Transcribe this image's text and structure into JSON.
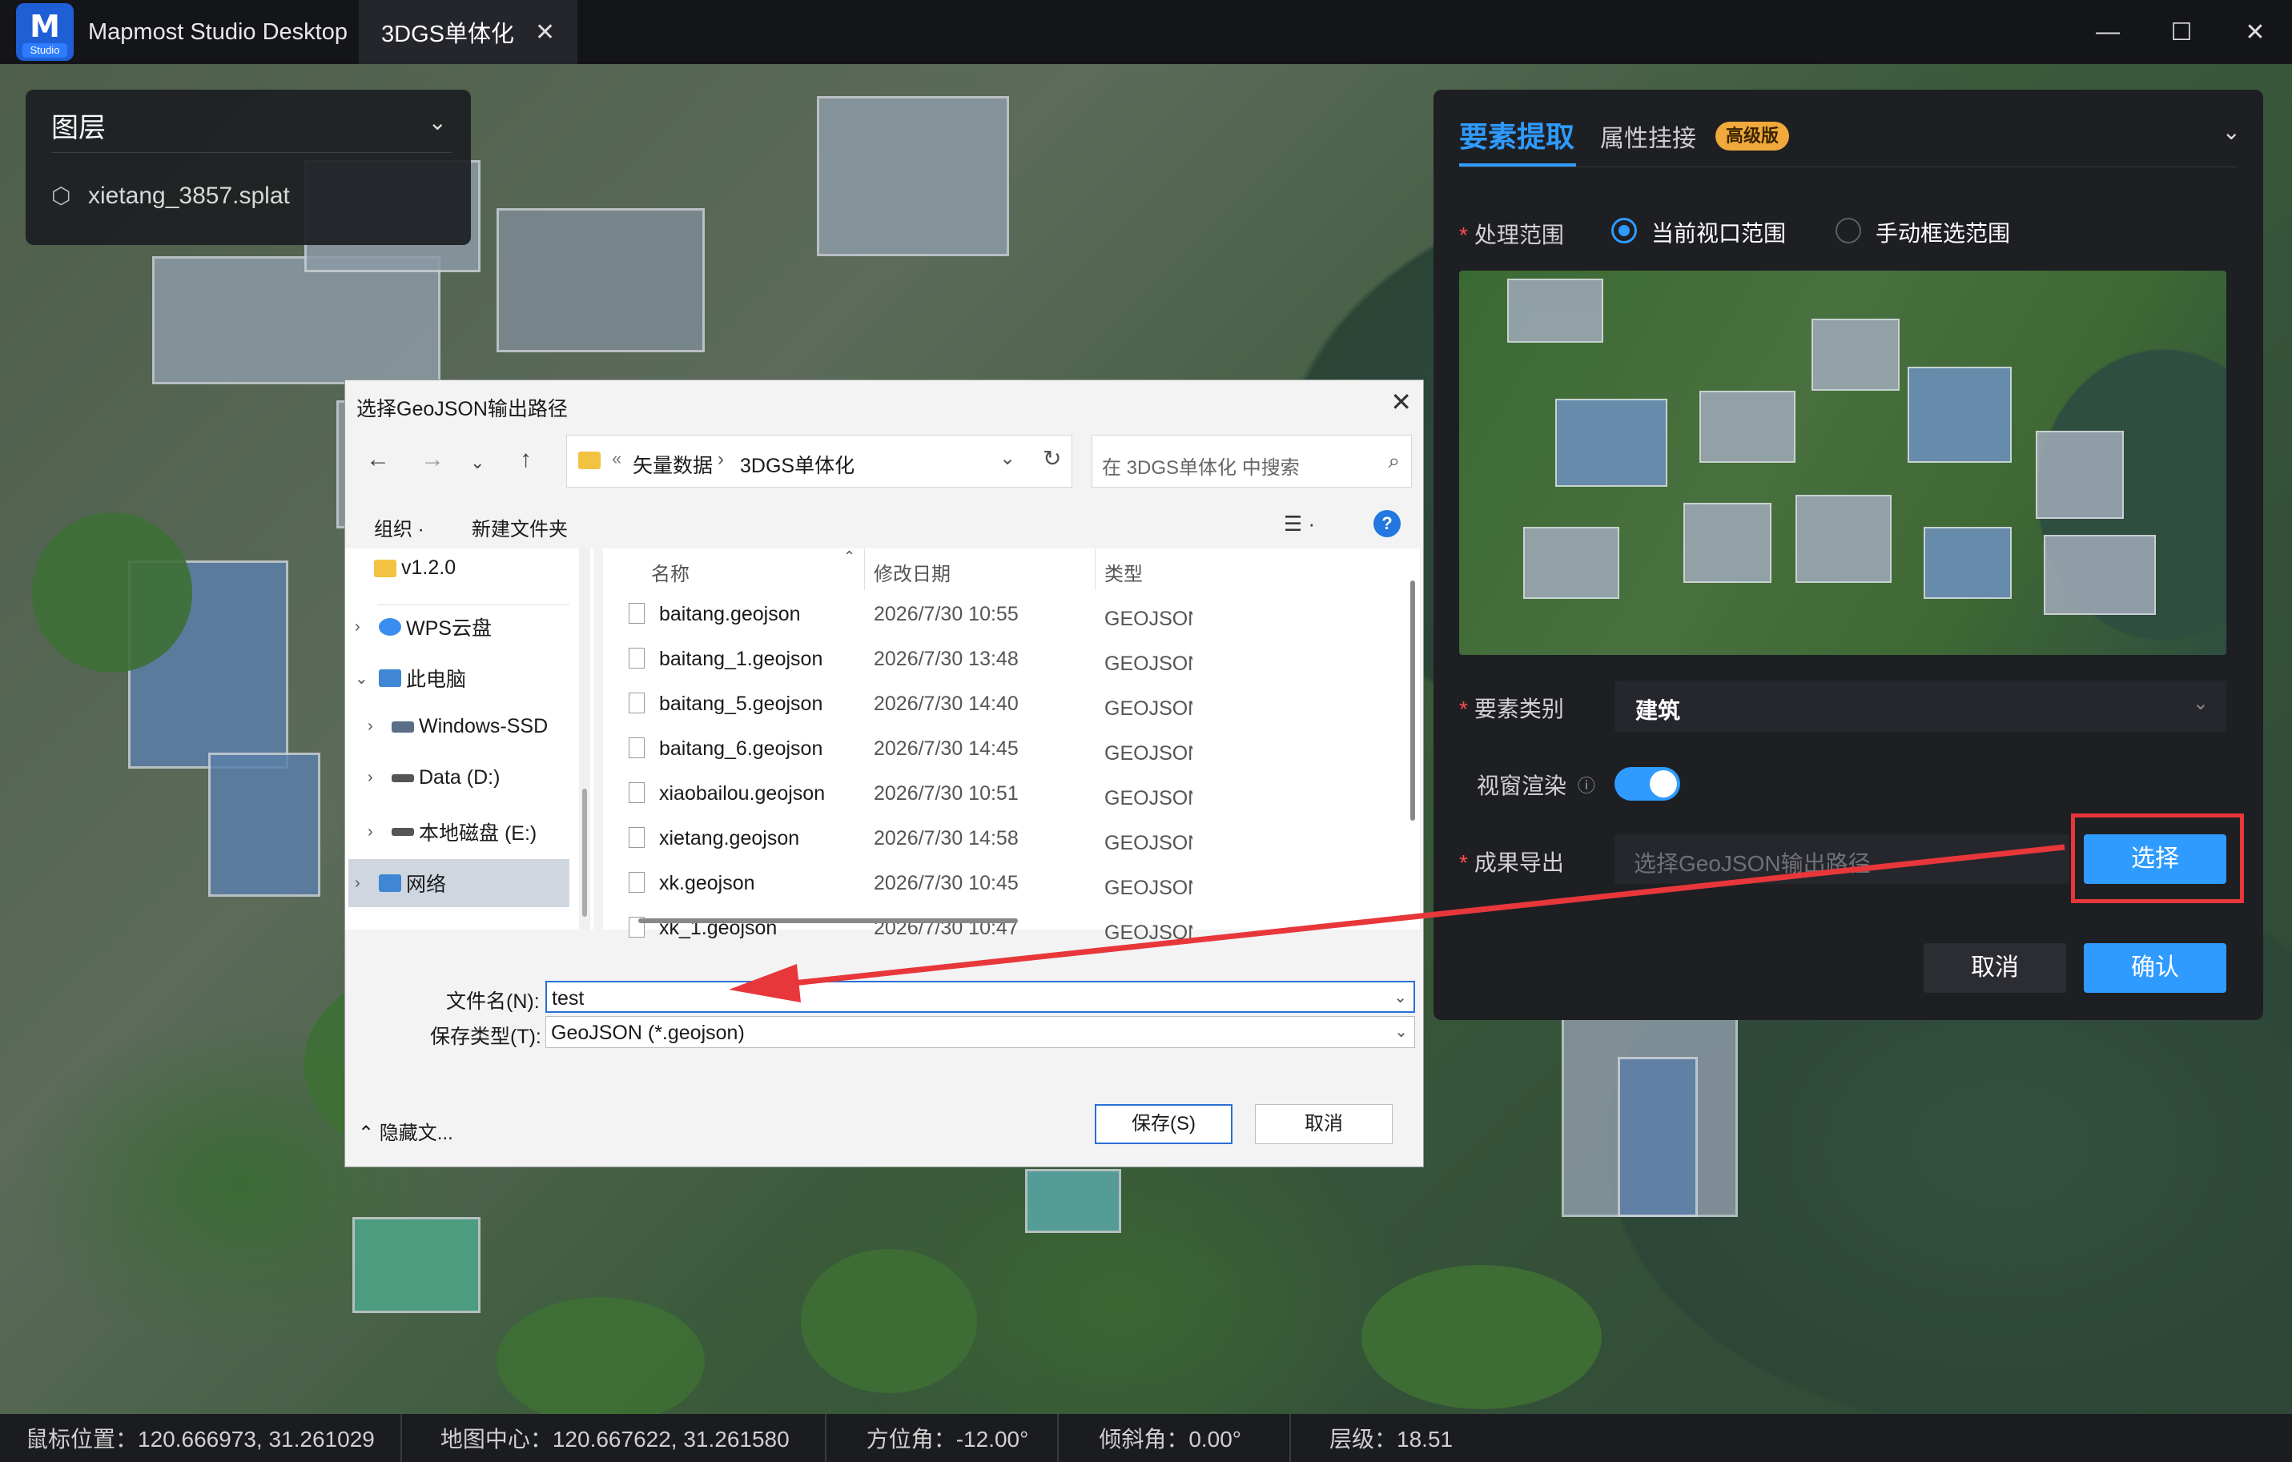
{
  "titlebar": {
    "logo_label": "Studio",
    "app_title": "Mapmost Studio Desktop",
    "tab_label": "3DGS单体化"
  },
  "layers_panel": {
    "title": "图层",
    "items": [
      {
        "label": "xietang_3857.splat",
        "icon": "cube-icon"
      }
    ]
  },
  "right_panel": {
    "tabs": {
      "extract": "要素提取",
      "attr": "属性挂接",
      "badge": "高级版"
    },
    "scope": {
      "label": "处理范围",
      "option_current": "当前视口范围",
      "option_manual": "手动框选范围",
      "selected": "当前视口范围"
    },
    "category": {
      "label": "要素类别",
      "value": "建筑"
    },
    "render": {
      "label": "视窗渲染",
      "enabled": true
    },
    "output": {
      "label": "成果导出",
      "placeholder": "选择GeoJSON输出路径",
      "choose_button": "选择"
    },
    "buttons": {
      "cancel": "取消",
      "confirm": "确认"
    },
    "accent_color": "#2f9bff",
    "highlight_color": "#e8373a"
  },
  "dialog": {
    "title": "选择GeoJSON输出路径",
    "path": {
      "segment1": "矢量数据",
      "segment2": "3DGS单体化"
    },
    "search_placeholder": "在 3DGS单体化 中搜索",
    "toolbar": {
      "organize": "组织 ·",
      "new_folder": "新建文件夹"
    },
    "nav": {
      "v120": "v1.2.0",
      "wps": "WPS云盘",
      "pc": "此电脑",
      "windows": "Windows-SSD",
      "data_d": "Data (D:)",
      "local_e": "本地磁盘 (E:)",
      "network": "网络"
    },
    "columns": {
      "name": "名称",
      "date": "修改日期",
      "type": "类型"
    },
    "files": [
      {
        "name": "baitang.geojson",
        "date": "2026/7/30 10:55",
        "type": "GEOJSON 文件"
      },
      {
        "name": "baitang_1.geojson",
        "date": "2026/7/30 13:48",
        "type": "GEOJSON 文件"
      },
      {
        "name": "baitang_5.geojson",
        "date": "2026/7/30 14:40",
        "type": "GEOJSON 文件"
      },
      {
        "name": "baitang_6.geojson",
        "date": "2026/7/30 14:45",
        "type": "GEOJSON 文件"
      },
      {
        "name": "xiaobailou.geojson",
        "date": "2026/7/30 10:51",
        "type": "GEOJSON 文件"
      },
      {
        "name": "xietang.geojson",
        "date": "2026/7/30 14:58",
        "type": "GEOJSON 文件"
      },
      {
        "name": "xk.geojson",
        "date": "2026/7/30 10:45",
        "type": "GEOJSON 文件"
      },
      {
        "name": "xk_1.geojson",
        "date": "2026/7/30 10:47",
        "type": "GEOJSON 文件"
      }
    ],
    "filename_label": "文件名(N):",
    "filename_value": "test",
    "filetype_label": "保存类型(T):",
    "filetype_value": "GeoJSON (*.geojson)",
    "hide_folders": "隐藏文...",
    "save_button": "保存(S)",
    "cancel_button": "取消"
  },
  "statusbar": {
    "mouse": "鼠标位置：120.666973, 31.261029",
    "center": "地图中心：120.667622, 31.261580",
    "bearing": "方位角：-12.00°",
    "pitch": "倾斜角：0.00°",
    "zoom": "层级：18.51"
  }
}
